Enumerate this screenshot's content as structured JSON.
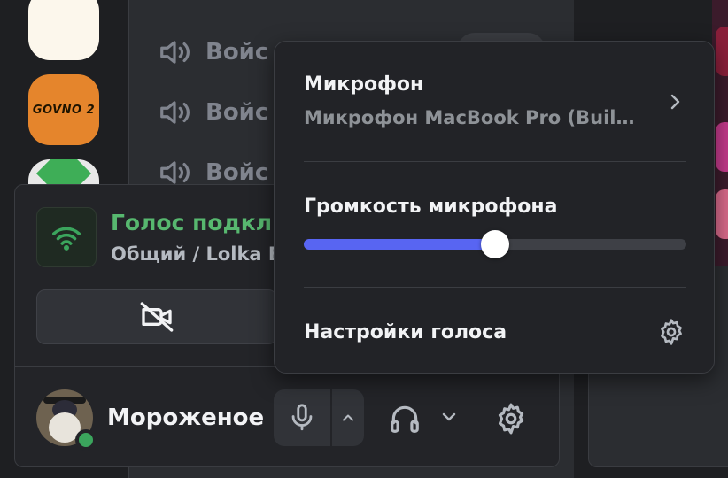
{
  "servers": [
    {
      "name": "blank-server"
    },
    {
      "name": "govno-server",
      "label": "GOVNO 2"
    },
    {
      "name": "green-server"
    }
  ],
  "channels": [
    {
      "label": "Войс"
    },
    {
      "label": "Войс"
    },
    {
      "label": "Войс"
    }
  ],
  "voice": {
    "status": "Голос подключ",
    "location": "Общий / Lolka E"
  },
  "user": {
    "name": "Мороженое",
    "status": "online"
  },
  "popup": {
    "mic_label": "Микрофон",
    "mic_device": "Микрофон MacBook Pro (Built-...",
    "volume_label": "Громкость микрофона",
    "volume_level": 0.5,
    "settings_label": "Настройки голоса"
  },
  "colors": {
    "accent": "#5865f2",
    "connected": "#57b86f",
    "online": "#3ba55d",
    "server_govno": "#e5852c"
  },
  "icons": [
    "speaker-icon",
    "wifi-icon",
    "camera-off-icon",
    "microphone-icon",
    "chevron-up-icon",
    "headphones-icon",
    "chevron-down-icon",
    "gear-icon",
    "chevron-right-icon"
  ]
}
